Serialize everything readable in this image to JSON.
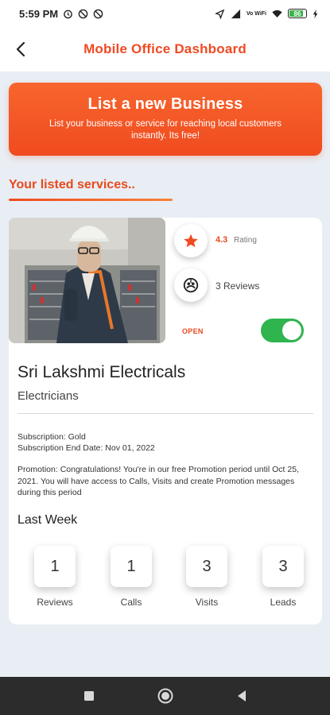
{
  "status_bar": {
    "time": "5:59 PM",
    "network_label": "Vo WiFi",
    "battery_level": "86"
  },
  "header": {
    "title": "Mobile Office Dashboard"
  },
  "banner": {
    "title": "List a new Business",
    "subtitle": "List your business or service for reaching local customers instantly. Its free!"
  },
  "section": {
    "title": "Your listed services.."
  },
  "listing": {
    "rating_value": "4.3",
    "rating_label": "Rating",
    "reviews_label": "3 Reviews",
    "open_label": "OPEN",
    "is_open": true,
    "business_name": "Sri Lakshmi Electricals",
    "category": "Electricians",
    "subscription": "Subscription: Gold",
    "subscription_end": "Subscription End Date: Nov 01, 2022",
    "promotion": "Promotion: Congratulations! You're in our free Promotion period until Oct 25, 2021. You will have access to Calls, Visits and create Promotion messages during this period",
    "last_week_title": "Last Week",
    "metrics": [
      {
        "value": "1",
        "label": "Reviews"
      },
      {
        "value": "1",
        "label": "Calls"
      },
      {
        "value": "3",
        "label": "Visits"
      },
      {
        "value": "3",
        "label": "Leads"
      }
    ]
  },
  "colors": {
    "accent": "#f04a23",
    "toggle_on": "#2fb44e",
    "nav_bar": "#2c2c2c"
  },
  "icons": [
    "alarm-icon",
    "dnd-icon",
    "location-icon",
    "signal-icon",
    "wifi-icon",
    "battery-icon",
    "charging-icon",
    "back-arrow-icon",
    "star-icon",
    "reviews-icon",
    "recent-apps-icon",
    "home-icon",
    "back-nav-icon"
  ]
}
